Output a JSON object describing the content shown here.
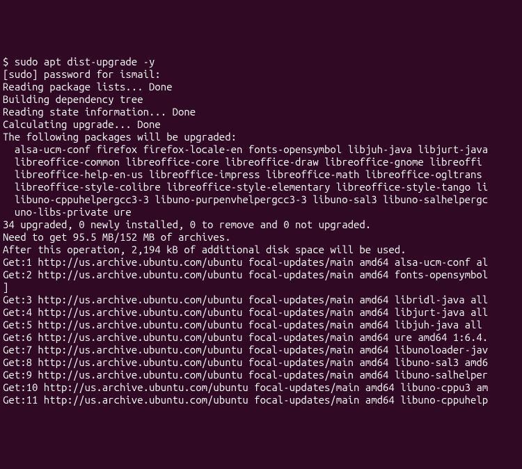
{
  "terminal": {
    "lines": [
      "$ sudo apt dist-upgrade -y",
      "[sudo] password for ismail:",
      "Reading package lists... Done",
      "Building dependency tree",
      "Reading state information... Done",
      "Calculating upgrade... Done",
      "The following packages will be upgraded:",
      "  alsa-ucm-conf firefox firefox-locale-en fonts-opensymbol libjuh-java libjurt-java",
      "  libreoffice-common libreoffice-core libreoffice-draw libreoffice-gnome libreoffi",
      "  libreoffice-help-en-us libreoffice-impress libreoffice-math libreoffice-ogltrans",
      "  libreoffice-style-colibre libreoffice-style-elementary libreoffice-style-tango li",
      "  libuno-cppuhelpergcc3-3 libuno-purpenvhelpergcc3-3 libuno-sal3 libuno-salhelpergc",
      "  uno-libs-private ure",
      "34 upgraded, 0 newly installed, 0 to remove and 0 not upgraded.",
      "Need to get 95.5 MB/152 MB of archives.",
      "After this operation, 2,194 kB of additional disk space will be used.",
      "Get:1 http://us.archive.ubuntu.com/ubuntu focal-updates/main amd64 alsa-ucm-conf al",
      "Get:2 http://us.archive.ubuntu.com/ubuntu focal-updates/main amd64 fonts-opensymbol",
      "]",
      "Get:3 http://us.archive.ubuntu.com/ubuntu focal-updates/main amd64 libridl-java all",
      "Get:4 http://us.archive.ubuntu.com/ubuntu focal-updates/main amd64 libjurt-java all",
      "Get:5 http://us.archive.ubuntu.com/ubuntu focal-updates/main amd64 libjuh-java all ",
      "Get:6 http://us.archive.ubuntu.com/ubuntu focal-updates/main amd64 ure amd64 1:6.4.",
      "Get:7 http://us.archive.ubuntu.com/ubuntu focal-updates/main amd64 libunoloader-jav",
      "Get:8 http://us.archive.ubuntu.com/ubuntu focal-updates/main amd64 libuno-sal3 amd6",
      "Get:9 http://us.archive.ubuntu.com/ubuntu focal-updates/main amd64 libuno-salhelper",
      "Get:10 http://us.archive.ubuntu.com/ubuntu focal-updates/main amd64 libuno-cppu3 am",
      "Get:11 http://us.archive.ubuntu.com/ubuntu focal-updates/main amd64 libuno-cppuhelp"
    ]
  }
}
